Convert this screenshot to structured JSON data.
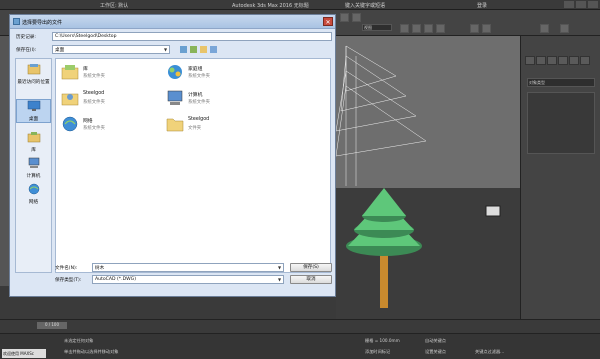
{
  "max": {
    "workspace": "工作区: 默认",
    "app_title": "Autodesk 3ds Max 2016    无标题",
    "search_placeholder": "键入关键字或短语",
    "signin": "登录",
    "toolbar_select": "视图",
    "cmd_field": "对象类型"
  },
  "dialog": {
    "title": "选择要导出的文件",
    "history_label": "历史记录:",
    "history_value": "C:\\Users\\Steelgod\\Desktop",
    "save_in_label": "保存在(I):",
    "save_in_value": "桌面",
    "close_glyph": "✕",
    "places": [
      {
        "label": "最近访问的位置",
        "icon": "recent-icon"
      },
      {
        "label": "桌面",
        "icon": "desktop-icon"
      },
      {
        "label": "库",
        "icon": "library-icon"
      },
      {
        "label": "计算机",
        "icon": "computer-icon"
      },
      {
        "label": "网络",
        "icon": "network-icon"
      }
    ],
    "files": [
      {
        "name": "库",
        "type": "系统文件夹",
        "icon": "library-icon"
      },
      {
        "name": "家庭组",
        "type": "系统文件夹",
        "icon": "homegroup-icon"
      },
      {
        "name": "Steelgod",
        "type": "系统文件夹",
        "icon": "user-icon"
      },
      {
        "name": "计算机",
        "type": "系统文件夹",
        "icon": "computer-icon"
      },
      {
        "name": "网络",
        "type": "系统文件夹",
        "icon": "network-icon"
      },
      {
        "name": "Steelgod",
        "type": "文件夹",
        "icon": "folder-icon"
      }
    ],
    "filename_label": "文件名(N):",
    "filename_value": "树木",
    "filetype_label": "保存类型(T):",
    "filetype_value": "AutoCAD (*.DWG)",
    "save_button": "保存(S)",
    "cancel_button": "取消"
  },
  "status": {
    "timeline_frame": "0 / 100",
    "line1": "未选定任何对象",
    "line2": "单击并拖动以选择并移动对象",
    "grid": "栅格 = 100.0mm",
    "add_time_tag": "添加时间标记",
    "auto_key": "自动关键点",
    "set_key": "设置关键点",
    "selected_obj": "选定对象",
    "key_filter": "关键点过滤器...",
    "welcome": "欢迎使用 MAXSc"
  },
  "colors": {
    "max_bg": "#444444",
    "dialog_bg": "#dce6f4",
    "tree_green": "#5ec77a",
    "trunk": "#c98a2e"
  }
}
